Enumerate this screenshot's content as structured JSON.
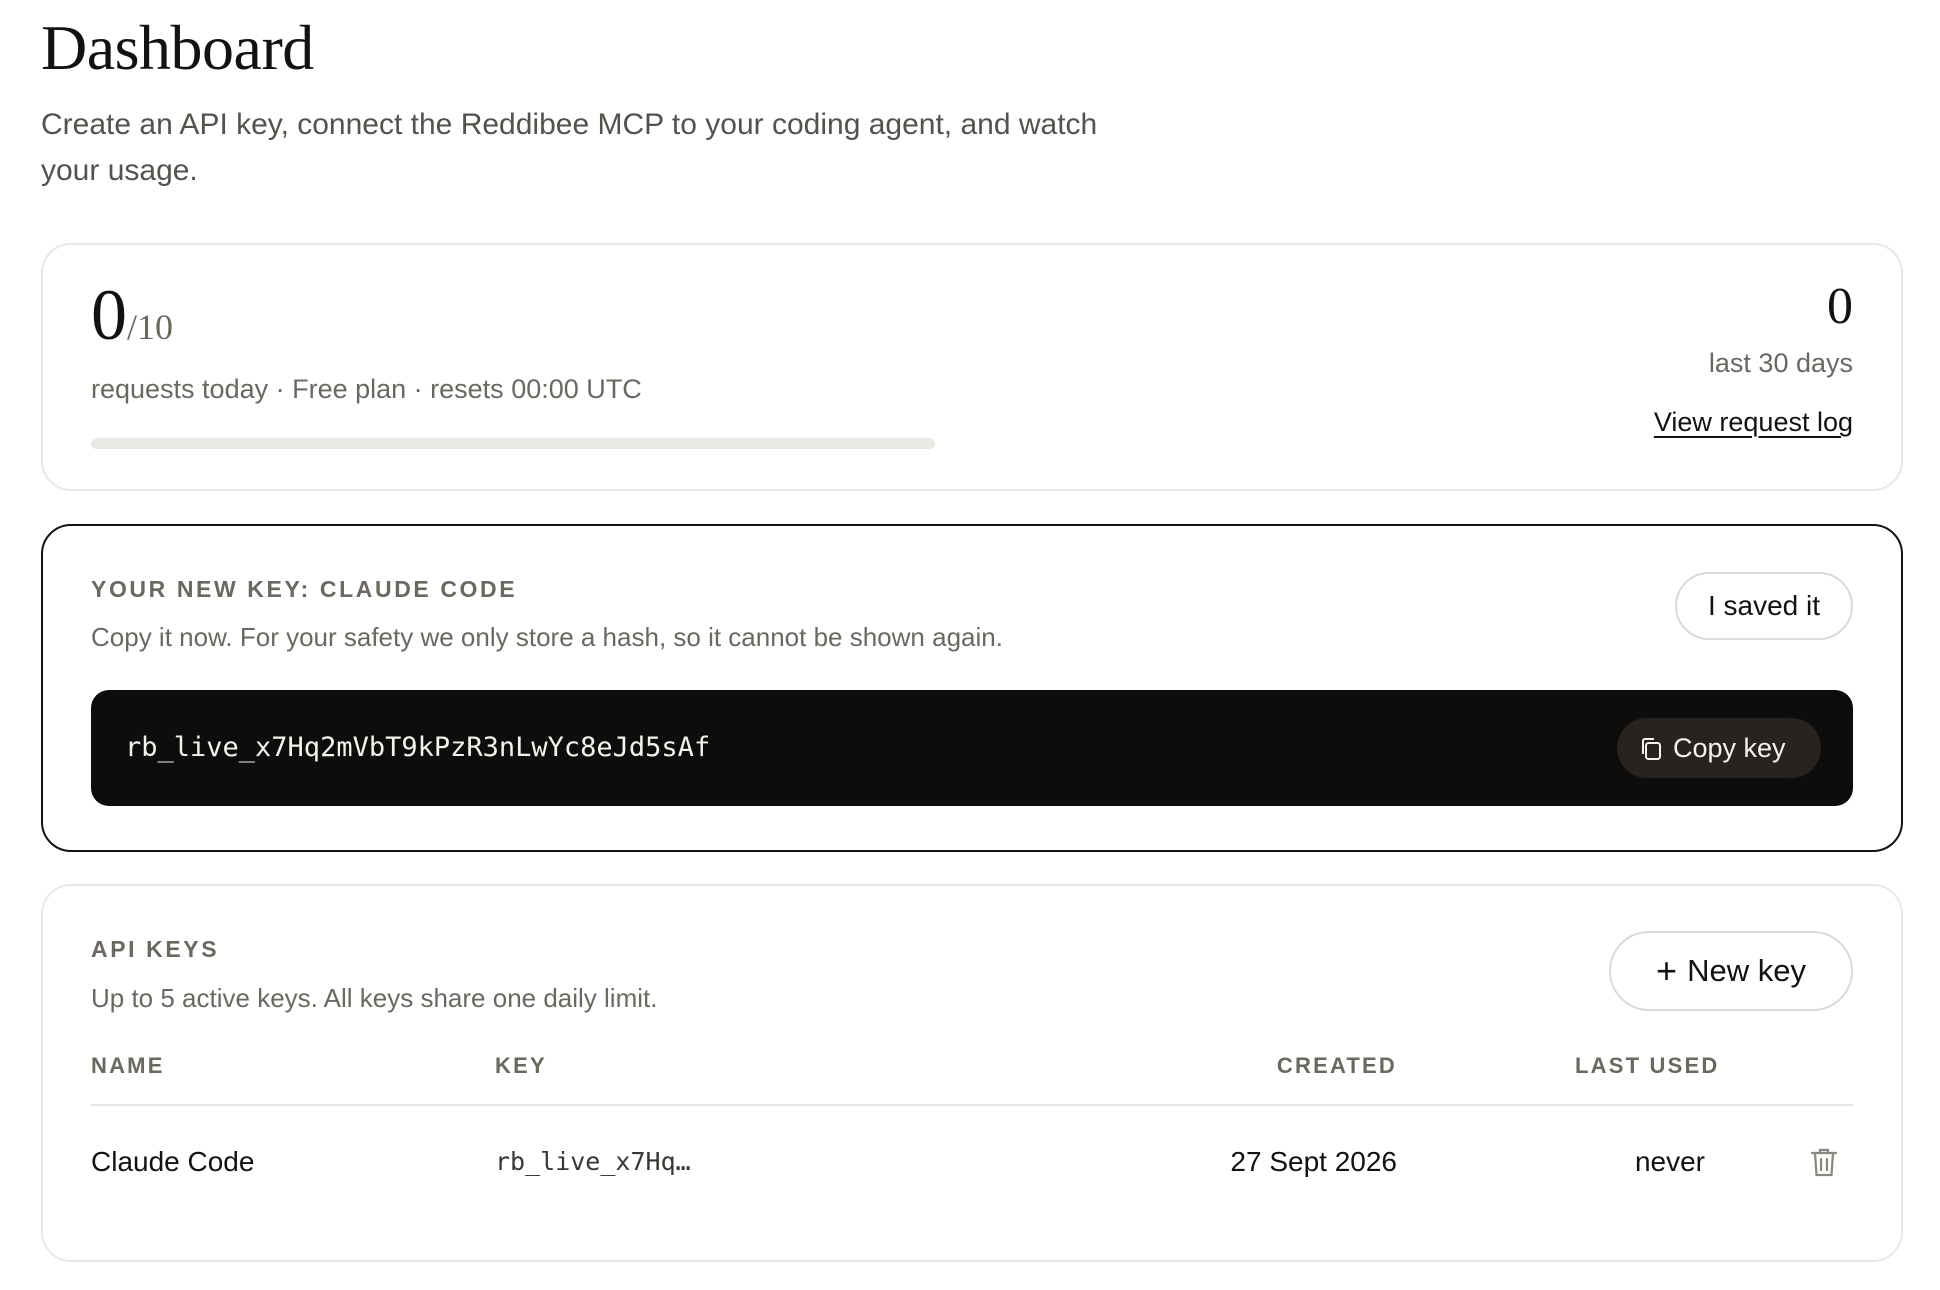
{
  "header": {
    "title": "Dashboard",
    "subtitle": "Create an API key, connect the Reddibee MCP to your coding agent, and watch your usage."
  },
  "usage": {
    "requests_today": "0",
    "limit": "/10",
    "meta": "requests today · Free plan · resets 00:00 UTC",
    "progress_fraction": 0,
    "month_count": "0",
    "month_label": "last 30 days",
    "log_link": "View request log"
  },
  "new_key": {
    "label": "YOUR NEW KEY: CLAUDE CODE",
    "description": "Copy it now. For your safety we only store a hash, so it cannot be shown again.",
    "saved_button": "I saved it",
    "key_value": "rb_live_x7Hq2mVbT9kPzR3nLwYc8eJd5sAf",
    "copy_button": "Copy key",
    "copy_icon": "copy-icon"
  },
  "api_keys": {
    "label": "API KEYS",
    "description": "Up to 5 active keys. All keys share one daily limit.",
    "new_button": "New key",
    "new_button_icon": "+",
    "columns": {
      "name": "NAME",
      "key": "KEY",
      "created": "CREATED",
      "last_used": "LAST USED"
    },
    "rows": [
      {
        "name": "Claude Code",
        "key": "rb_live_x7Hq…",
        "created": "27 Sept 2026",
        "last_used": "never",
        "action_icon": "trash-icon"
      }
    ]
  },
  "colors": {
    "text": "#141210",
    "muted": "#6b6862",
    "border": "#ebe8e3",
    "key_box": "#0f0d0b"
  }
}
